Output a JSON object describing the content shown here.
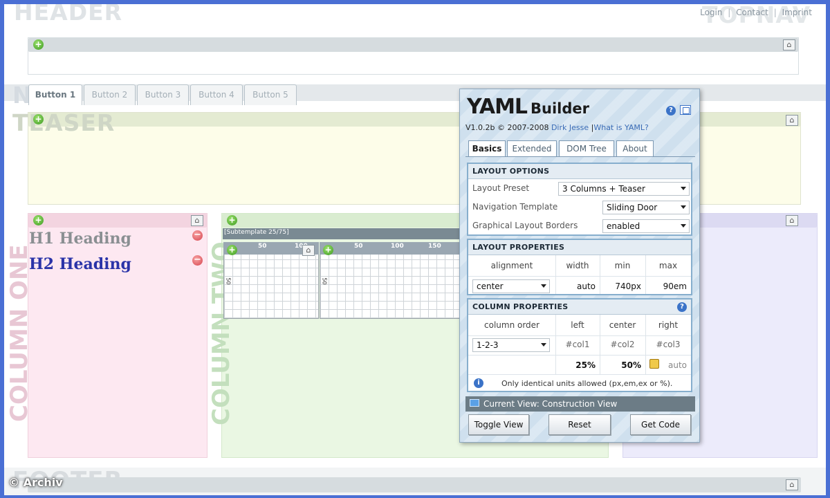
{
  "watermarks": {
    "header": "HEADER",
    "topnav": "TOPNAV",
    "nav": "NAV",
    "teaser": "TEASER",
    "column_one": "COLUMN ONE",
    "column_two": "COLUMN TWO",
    "footer": "FOOTER"
  },
  "topnav_links": {
    "login": "Login",
    "contact": "Contact",
    "imprint": "Imprint",
    "separator": "|"
  },
  "nav_tabs": [
    "Button 1",
    "Button 2",
    "Button 3",
    "Button 4",
    "Button 5"
  ],
  "column_one": {
    "h1": "H1 Heading",
    "h2": "H2 Heading"
  },
  "subtemplate": {
    "label": "[Subtemplate 25/75]",
    "left_ruler": [
      "50",
      "100"
    ],
    "right_ruler": [
      "50",
      "100",
      "150"
    ],
    "v_ruler": [
      "50",
      "50"
    ]
  },
  "icons": {
    "add": "+",
    "remove": "−",
    "lock": "⌂"
  },
  "builder": {
    "logo": "YAML",
    "logo_suffix": "Builder",
    "version": "V1.0.2b © 2007-2008",
    "author": "Dirk Jesse",
    "version_sep": "|",
    "what_is": "What is YAML?",
    "help_icon": "?",
    "tabs": [
      "Basics",
      "Extended",
      "DOM Tree",
      "About"
    ],
    "layout_options": {
      "title": "LAYOUT OPTIONS",
      "preset_label": "Layout Preset",
      "preset_value": "3 Columns + Teaser",
      "nav_label": "Navigation Template",
      "nav_value": "Sliding Door",
      "borders_label": "Graphical Layout Borders",
      "borders_value": "enabled"
    },
    "layout_properties": {
      "title": "LAYOUT PROPERTIES",
      "headers": [
        "alignment",
        "width",
        "min",
        "max"
      ],
      "alignment": "center",
      "width": "auto",
      "min": "740px",
      "max": "90em"
    },
    "column_properties": {
      "title": "COLUMN PROPERTIES",
      "headers": [
        "column order",
        "left",
        "center",
        "right"
      ],
      "order": "1-2-3",
      "ids": [
        "#col1",
        "#col2",
        "#col3"
      ],
      "left_width": "25%",
      "center_width": "50%",
      "right_width": "auto",
      "note": "Only identical units allowed (px,em,ex or %).",
      "info_icon": "i"
    },
    "current_view": "Current View: Construction View",
    "buttons": {
      "toggle": "Toggle View",
      "reset": "Reset",
      "get_code": "Get Code"
    }
  },
  "credit": "© Archiv",
  "colors": {
    "frame": "#4a6fd4",
    "teaser_bg": "#fdfde9",
    "col1_bg": "#fde8f1",
    "col2_bg": "#eaf7e3",
    "col3_bg": "#ecebfb",
    "builder_bg": "#cfe0ee",
    "h2": "#2a33a8"
  }
}
